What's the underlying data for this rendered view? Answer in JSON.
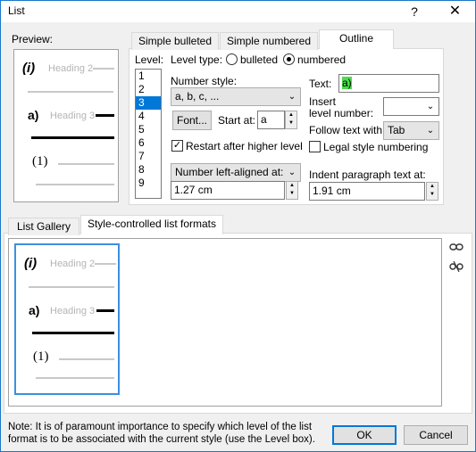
{
  "window": {
    "title": "List",
    "help_glyph": "?",
    "close_glyph": "✕"
  },
  "preview": {
    "label": "Preview:",
    "items": [
      {
        "num": "(i)",
        "heading": "Heading 2"
      },
      {
        "num": "a)",
        "heading": "Heading 3"
      },
      {
        "num": "(1)",
        "heading": ""
      }
    ]
  },
  "tabs_top": [
    "Simple bulleted",
    "Simple numbered",
    "Outline"
  ],
  "outline": {
    "level_label": "Level:",
    "levels": [
      "1",
      "2",
      "3",
      "4",
      "5",
      "6",
      "7",
      "8",
      "9"
    ],
    "selected_level": "3",
    "level_type_label": "Level type:",
    "bulleted_label": "bulleted",
    "numbered_label": "numbered",
    "number_style_label": "Number style:",
    "number_style_value": "a, b, c, ...",
    "font_button": "Font...",
    "start_at_label": "Start at:",
    "start_at_value": "a",
    "restart_label": "Restart after higher level",
    "restart_checked": true,
    "alignment_value": "Number left-aligned at:",
    "alignment_amount": "1.27 cm",
    "text_label": "Text:",
    "text_value": "a)",
    "insert_level_label_1": "Insert",
    "insert_level_label_2": "level number:",
    "insert_level_value": "",
    "follow_text_label": "Follow text with:",
    "follow_text_value": "Tab",
    "legal_label": "Legal style numbering",
    "legal_checked": false,
    "indent_label": "Indent paragraph text at:",
    "indent_value": "1.91 cm"
  },
  "tabs_bottom": [
    "List Gallery",
    "Style-controlled list formats"
  ],
  "gallery": {
    "items": [
      {
        "num": "(i)",
        "heading": "Heading 2"
      },
      {
        "num": "a)",
        "heading": "Heading 3"
      },
      {
        "num": "(1)",
        "heading": ""
      }
    ],
    "side_icons": [
      "link-icon",
      "unlink-icon"
    ]
  },
  "footer": {
    "note": "Note: It is of paramount importance to specify which level of the list format is to be associated with the current style (use the Level box).",
    "ok": "OK",
    "cancel": "Cancel"
  }
}
